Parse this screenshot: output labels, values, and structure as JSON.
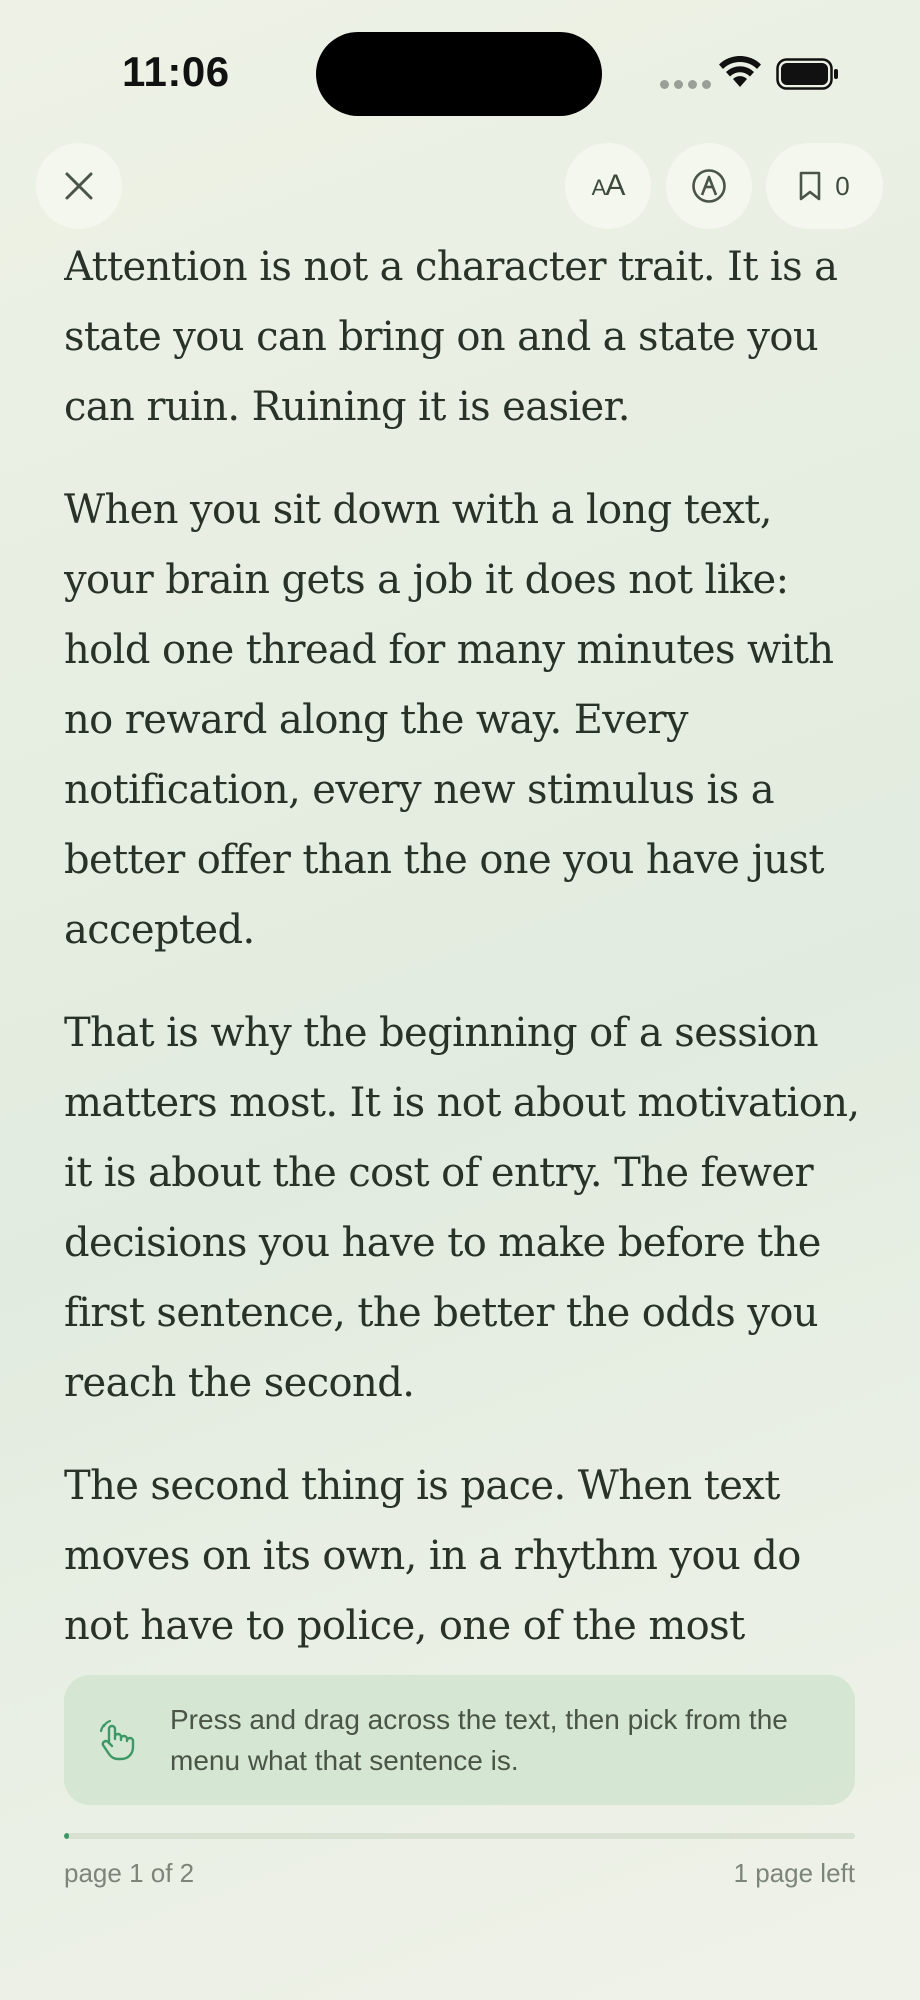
{
  "status": {
    "time": "11:06"
  },
  "toolbar": {
    "close_icon": "close-icon",
    "font_label_small": "A",
    "font_label_large": "A",
    "highlight_icon": "pen-circle-icon",
    "bookmark_icon": "bookmark-icon",
    "bookmark_count": "0"
  },
  "reader": {
    "paragraphs": [
      "Attention is not a character trait. It is a state you can bring on and a state you can ruin. Ruining it is easier.",
      "When you sit down with a long text, your brain gets a job it does not like: hold one thread for many minutes with no reward along the way. Every notification, every new stimulus is a better offer than the one you have just accepted.",
      "That is why the beginning of a session matters most. It is not about motivation, it is about the cost of entry. The fewer decisions you have to make before the first sentence, the better the odds you reach the second.",
      "The second thing is pace. When text moves on its own, in a rhythm you do not have to police, one of the most"
    ]
  },
  "hint": {
    "icon": "hand-pointer-icon",
    "text": "Press and drag across the text, then pick from the menu what that sentence is."
  },
  "footer": {
    "progress_fraction": 0.005,
    "page_label": "page 1 of 2",
    "pages_left": "1 page left"
  },
  "colors": {
    "accent": "#3e9866",
    "text": "#283226"
  }
}
